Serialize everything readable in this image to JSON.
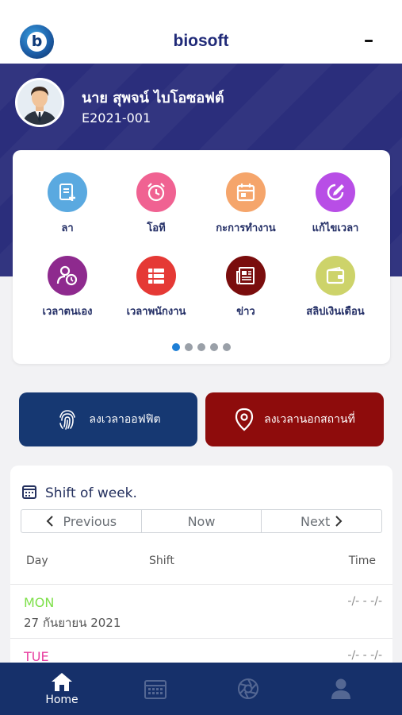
{
  "app": {
    "title": "biosoft"
  },
  "user": {
    "name": "นาย สุพจน์ ไบโอซอฟต์",
    "employee_id": "E2021-001"
  },
  "menu": {
    "items": [
      {
        "label": "ลา",
        "icon": "leave-form-icon",
        "color": "#5aa9e0"
      },
      {
        "label": "โอที",
        "icon": "alarm-clock-icon",
        "color": "#f06292"
      },
      {
        "label": "กะการทำงาน",
        "icon": "calendar-icon",
        "color": "#f5a56b"
      },
      {
        "label": "แก้ไขเวลา",
        "icon": "edit-icon",
        "color": "#b84ee6"
      },
      {
        "label": "เวลาตนเอง",
        "icon": "user-clock-icon",
        "color": "#8e2a8e"
      },
      {
        "label": "เวลาพนักงาน",
        "icon": "list-icon",
        "color": "#e53935"
      },
      {
        "label": "ข่าว",
        "icon": "newspaper-icon",
        "color": "#7a0d0d"
      },
      {
        "label": "สลิปเงินเดือน",
        "icon": "wallet-icon",
        "color": "#cdd36a"
      }
    ],
    "pages": 5,
    "active_page": 1
  },
  "actions": {
    "office": {
      "label": "ลงเวลาออฟฟิต",
      "icon": "fingerprint-icon",
      "color": "#163872"
    },
    "outside": {
      "label": "ลงเวลานอกสถานที่",
      "icon": "location-pin-icon",
      "color": "#8e0c0c"
    }
  },
  "shift": {
    "title": "Shift of week.",
    "nav": {
      "previous": "Previous",
      "now": "Now",
      "next": "Next"
    },
    "columns": {
      "day": "Day",
      "shift": "Shift",
      "time": "Time"
    },
    "rows": [
      {
        "day": "MON",
        "date": "27 กันยายน 2021",
        "time": "-/- -  -/-",
        "color": "#7ee04a"
      },
      {
        "day": "TUE",
        "date": "",
        "time": "-/- -  -/-",
        "color": "#e83ea0"
      }
    ]
  },
  "bottom_nav": {
    "items": [
      {
        "label": "Home",
        "icon": "home-icon",
        "active": true
      },
      {
        "label": "",
        "icon": "calendar-icon",
        "active": false
      },
      {
        "label": "",
        "icon": "aperture-icon",
        "active": false
      },
      {
        "label": "",
        "icon": "user-icon",
        "active": false
      }
    ]
  }
}
